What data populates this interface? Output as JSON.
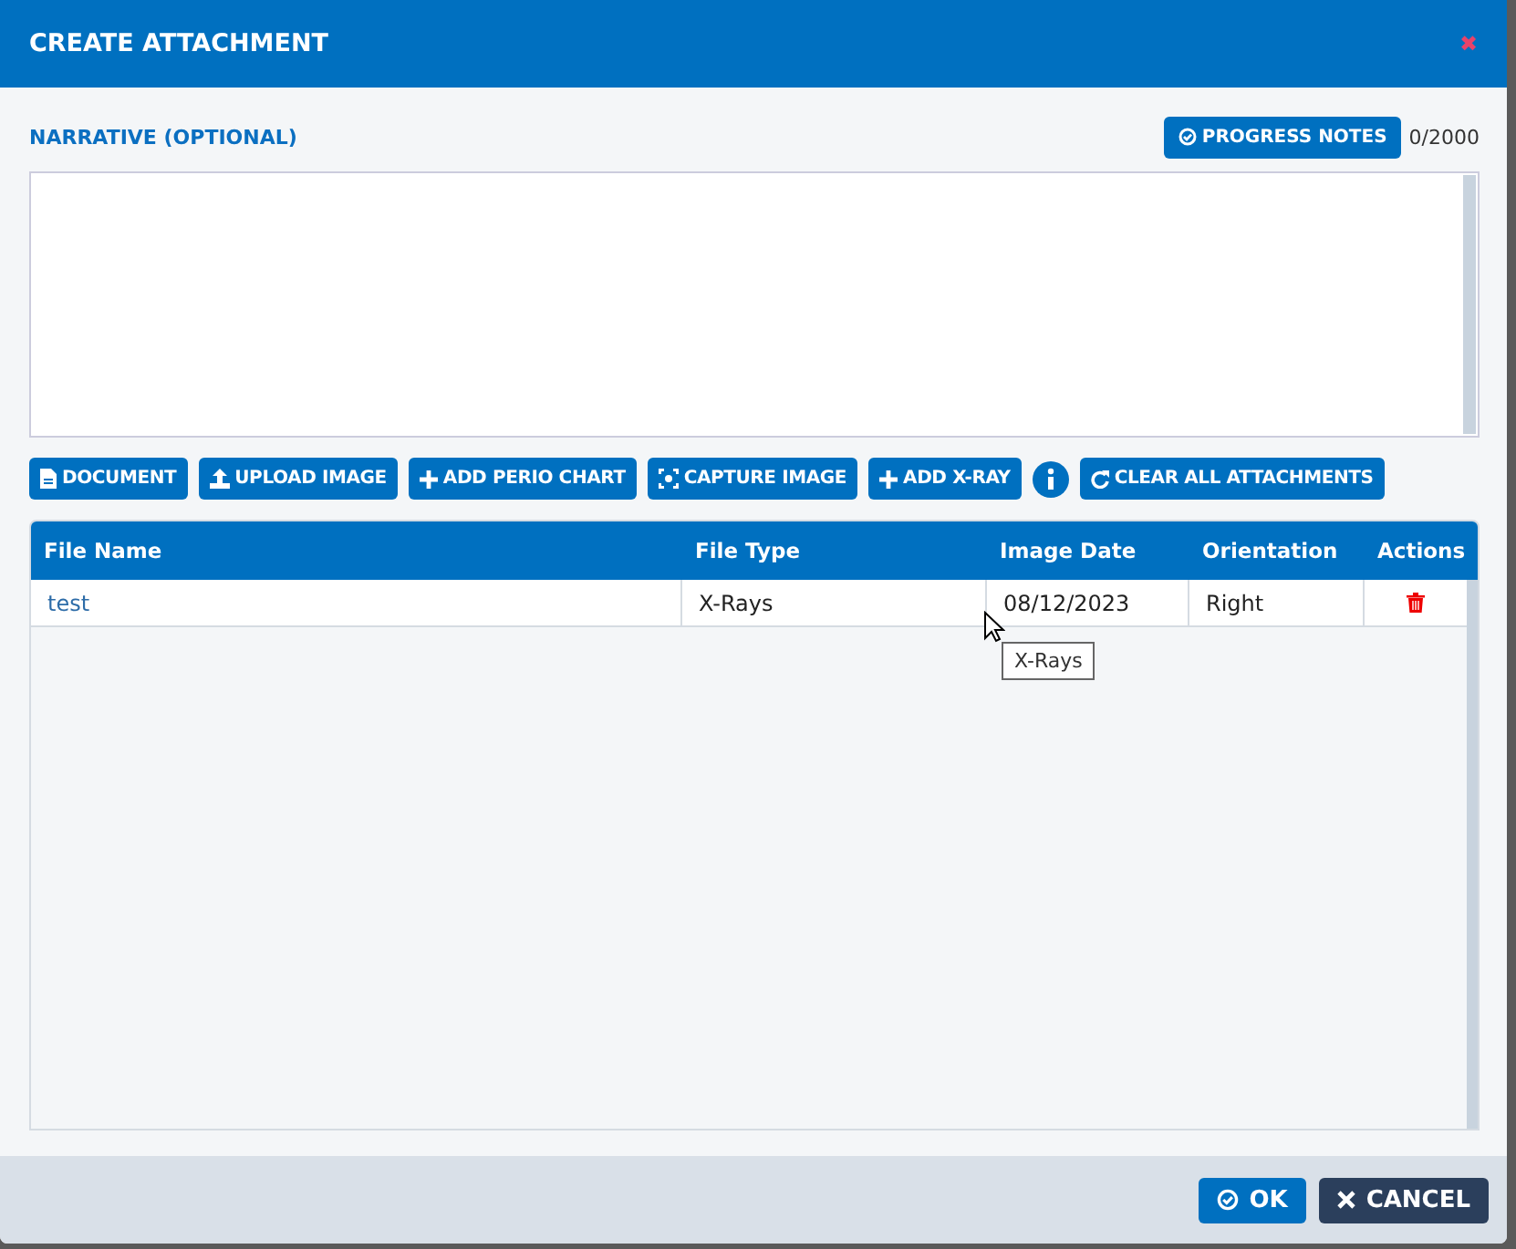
{
  "window": {
    "title": "CREATE ATTACHMENT",
    "close": "✖"
  },
  "narrative": {
    "label": "NARRATIVE (OPTIONAL)",
    "notes_button": "PROGRESS NOTES",
    "counter": "0/2000"
  },
  "toolbar": [
    {
      "kind": "document",
      "label": "DOCUMENT"
    },
    {
      "kind": "upload",
      "label": "UPLOAD IMAGE"
    },
    {
      "kind": "plus",
      "label": "ADD PERIO CHART"
    },
    {
      "kind": "capture",
      "label": "CAPTURE IMAGE"
    },
    {
      "kind": "plus",
      "label": "ADD X-RAY"
    },
    {
      "kind": "info"
    },
    {
      "kind": "refresh",
      "label": "CLEAR ALL ATTACHMENTS"
    }
  ],
  "table": {
    "columns": [
      "File Name",
      "File Type",
      "Image Date",
      "Orientation",
      "Actions"
    ],
    "rows": [
      {
        "file_name": "test",
        "file_type": "X-Rays",
        "image_date": "08/12/2023",
        "orientation": "Right"
      }
    ]
  },
  "tooltip": "X-Rays",
  "footer": {
    "ok": "OK",
    "cancel": "CANCEL"
  }
}
